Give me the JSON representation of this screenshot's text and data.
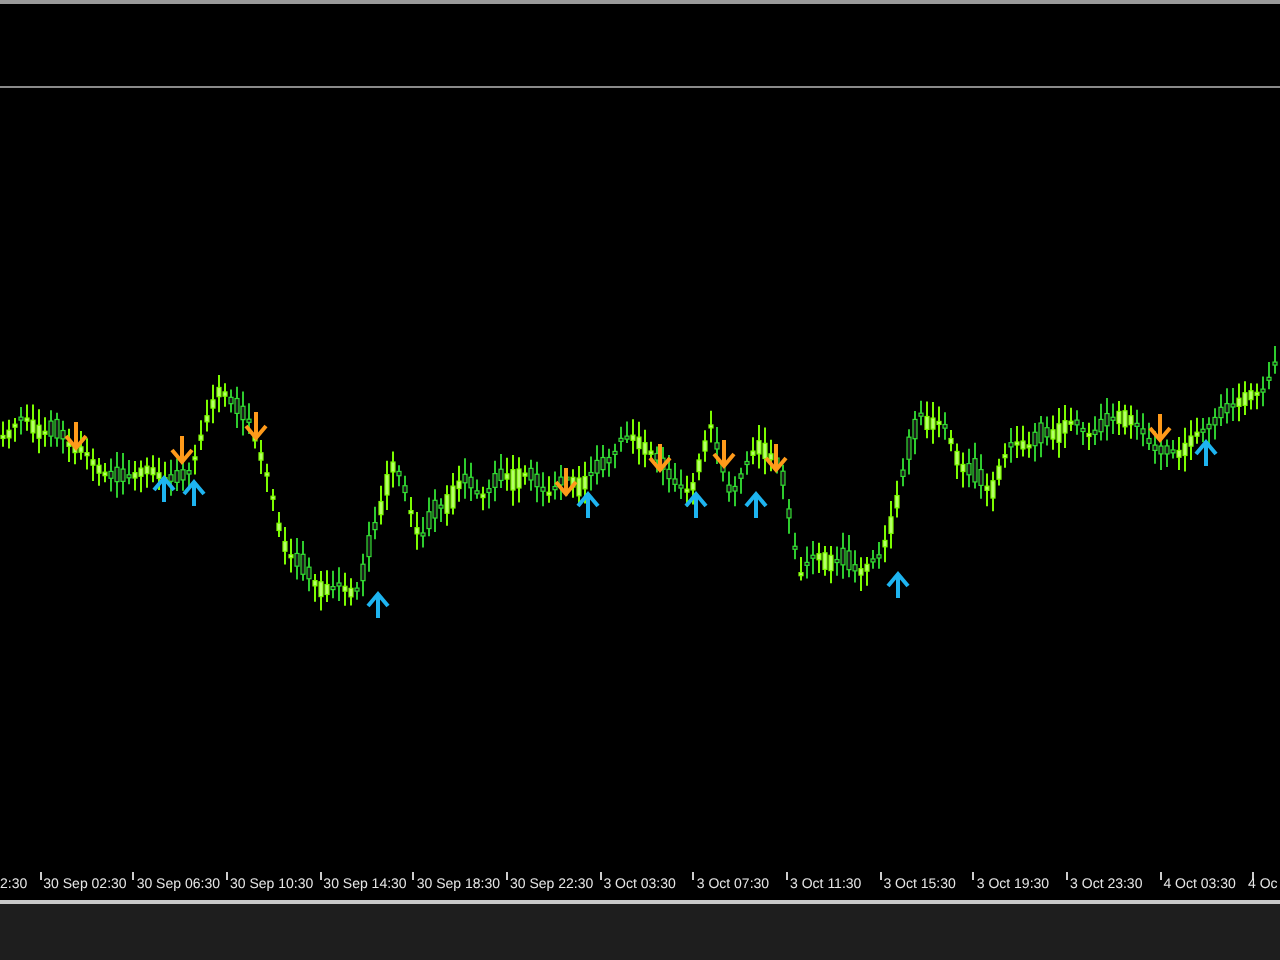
{
  "time_axis": {
    "labels": [
      "2:30",
      "30 Sep 02:30",
      "30 Sep 06:30",
      "30 Sep 10:30",
      "30 Sep 14:30",
      "30 Sep 18:30",
      "30 Sep 22:30",
      "3 Oct 03:30",
      "3 Oct 07:30",
      "3 Oct 11:30",
      "3 Oct 15:30",
      "3 Oct 19:30",
      "3 Oct 23:30",
      "4 Oct 03:30",
      "4 Oc"
    ]
  }
}
